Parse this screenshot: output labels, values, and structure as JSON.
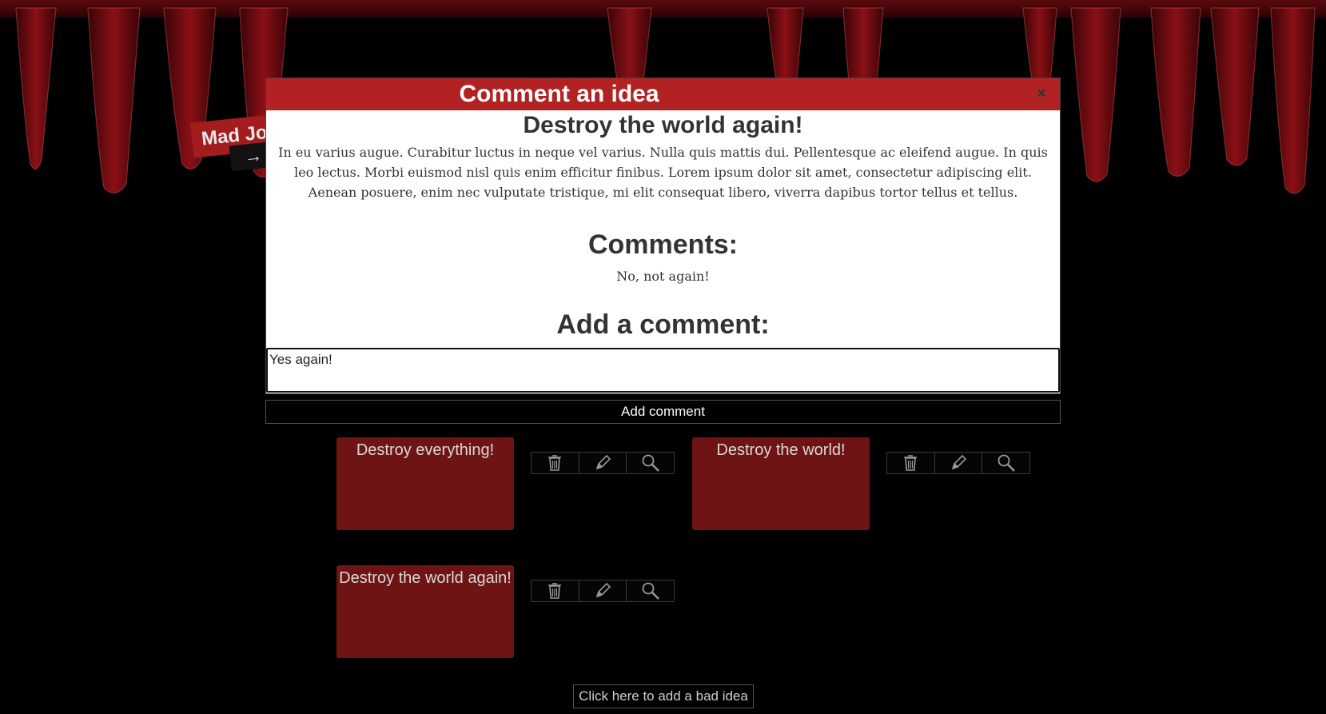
{
  "app": {
    "logo_text": "Mad Jo",
    "logo_arrow": "→"
  },
  "modal": {
    "header": "Comment an idea",
    "close_label": "×",
    "idea_title": "Destroy the world again!",
    "idea_description": "In eu varius augue. Curabitur luctus in neque vel varius. Nulla quis mattis dui. Pellentesque ac eleifend augue. In quis leo lectus. Morbi euismod nisl quis enim efficitur finibus. Lorem ipsum dolor sit amet, consectetur adipiscing elit. Aenean posuere, enim nec vulputate tristique, mi elit consequat libero, viverra dapibus tortor tellus et tellus.",
    "comments_heading": "Comments:",
    "comments": [
      "No, not again!"
    ],
    "add_heading": "Add a comment:",
    "comment_value": "Yes again!",
    "add_button": "Add comment"
  },
  "ideas": [
    {
      "title": "Destroy everything!"
    },
    {
      "title": "Destroy the world!"
    },
    {
      "title": "Destroy the world again!"
    }
  ],
  "icons": [
    "trash-icon",
    "pencil-icon",
    "magnifier-icon"
  ],
  "add_idea_button": "Click here to add a bad idea",
  "colors": {
    "header": "#b22222",
    "card": "#6e1414",
    "background": "#000000"
  }
}
